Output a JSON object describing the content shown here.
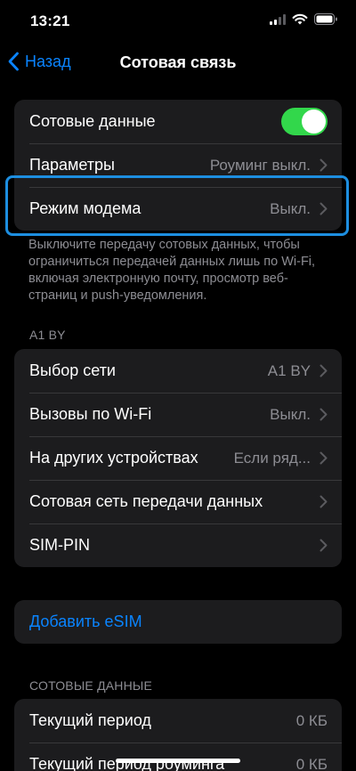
{
  "status_bar": {
    "time": "13:21",
    "icons": [
      "cellular-signal-icon",
      "wifi-icon",
      "battery-icon"
    ]
  },
  "nav": {
    "back_label": "Назад",
    "title": "Сотовая связь"
  },
  "group1": {
    "cellular_data_label": "Сотовые данные",
    "cellular_data_on": true,
    "options_label": "Параметры",
    "options_value": "Роуминг выкл.",
    "hotspot_label": "Режим модема",
    "hotspot_value": "Выкл."
  },
  "group1_footer": "Выключите передачу сотовых данных, чтобы ограничиться передачей данных лишь по Wi-Fi, включая электронную почту, просмотр веб-страниц и push-уведомления.",
  "carrier_header": "A1 BY",
  "group2": {
    "network_label": "Выбор сети",
    "network_value": "A1 BY",
    "wifi_calls_label": "Вызовы по Wi-Fi",
    "wifi_calls_value": "Выкл.",
    "other_devices_label": "На других устройствах",
    "other_devices_value": "Если ряд...",
    "data_network_label": "Сотовая сеть передачи данных",
    "sim_pin_label": "SIM-PIN"
  },
  "add_esim_label": "Добавить eSIM",
  "data_header": "СОТОВЫЕ ДАННЫЕ",
  "group3": {
    "current_period_label": "Текущий период",
    "current_period_value": "0 КБ",
    "roaming_period_label": "Текущий период роуминга",
    "roaming_period_value": "0 КБ"
  },
  "colors": {
    "accent": "#0a84ff",
    "toggle_on": "#32d74b",
    "highlight": "#1d8ee0",
    "cell_bg": "#1c1c1e",
    "secondary_text": "#8d8d93"
  }
}
